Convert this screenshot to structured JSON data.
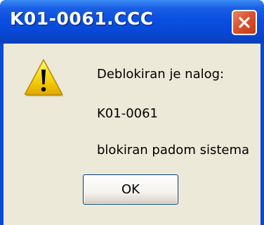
{
  "window": {
    "title": "K01-0061.CCC",
    "title_color": "#ffffff",
    "titlebar_color": "#0a4fe0",
    "client_color": "#ece9d8"
  },
  "close_button": {
    "icon": "close-icon",
    "color": "#d8542f"
  },
  "dialog": {
    "icon": "warning-icon",
    "icon_color": "#f5d30a",
    "lines": [
      "Deblokiran je nalog:",
      "K01-0061",
      "blokiran padom sistema"
    ]
  },
  "buttons": {
    "ok_label": "OK"
  }
}
